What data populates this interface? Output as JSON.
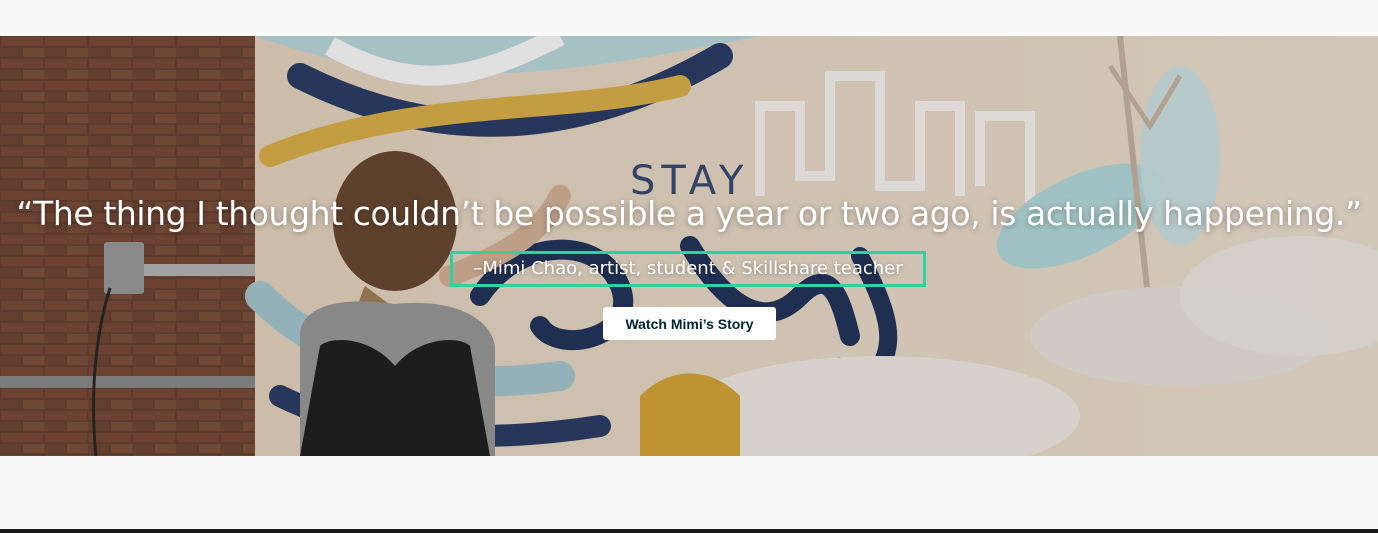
{
  "hero": {
    "quote": "“The thing I thought couldn’t be possible a year or two ago, is actually happening.”",
    "attribution": "–Mimi Chao, artist, student & Skillshare teacher",
    "watch_button_label": "Watch Mimi’s Story",
    "mural_text": "STAY"
  },
  "colors": {
    "highlight_border": "#2fd0a1",
    "button_text": "#002333",
    "page_background": "#f9f9f9"
  }
}
